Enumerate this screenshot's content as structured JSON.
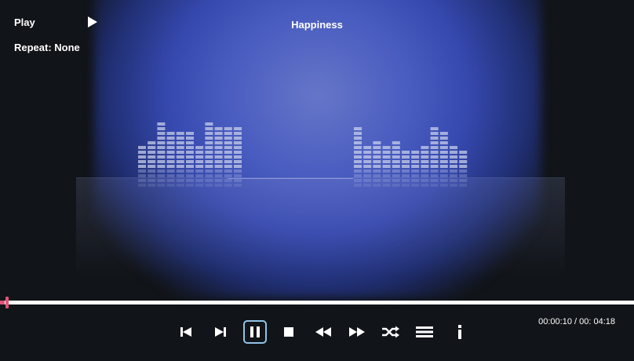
{
  "player": {
    "state_label": "Play",
    "repeat_label": "Repeat: None",
    "track_title": "Happiness",
    "time_display": "00:00:10 / 00: 04:18",
    "progress_fraction": 0.008
  },
  "controls": [
    {
      "name": "previous-track-icon"
    },
    {
      "name": "next-track-icon"
    },
    {
      "name": "pause-icon"
    },
    {
      "name": "stop-icon"
    },
    {
      "name": "rewind-icon"
    },
    {
      "name": "fast-forward-icon"
    },
    {
      "name": "shuffle-icon"
    },
    {
      "name": "playlist-icon"
    },
    {
      "name": "info-icon"
    }
  ],
  "colors": {
    "background": "#111418",
    "glow": "#4a5dc0",
    "progress_track": "#ffffff",
    "progress_thumb": "#e0557a",
    "pause_outline": "#8fc4e8",
    "text": "#ffffff"
  },
  "equalizer": {
    "left_levels": [
      5,
      6,
      10,
      8,
      8,
      8,
      5,
      10,
      9,
      9,
      9
    ],
    "right_levels": [
      9,
      5,
      6,
      5,
      6,
      4,
      4,
      5,
      9,
      8,
      5,
      4
    ]
  }
}
